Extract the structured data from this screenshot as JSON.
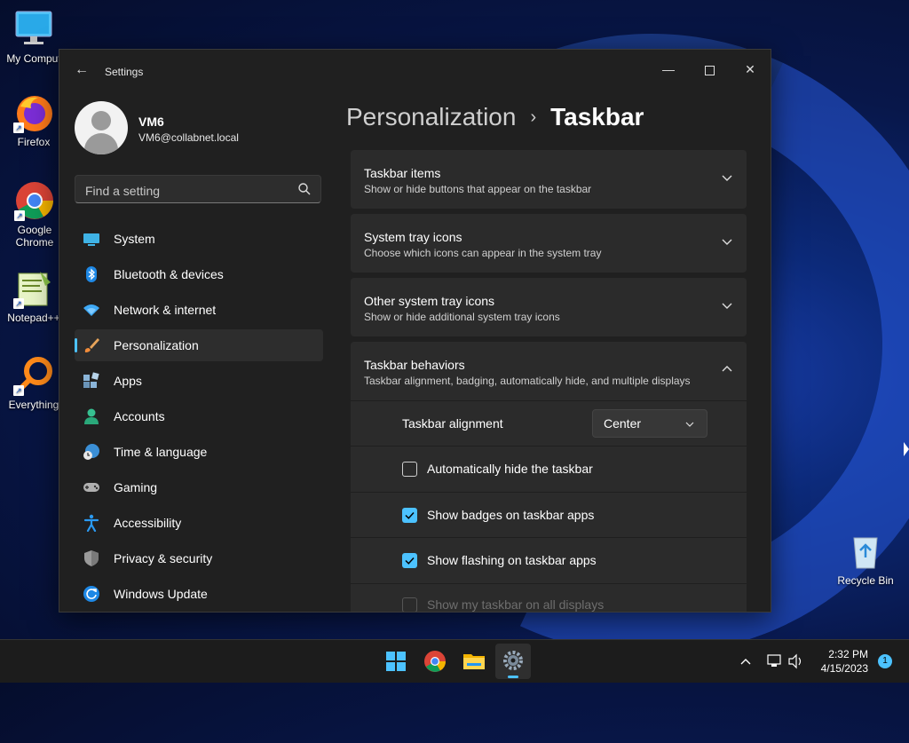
{
  "desktop": {
    "icons": [
      {
        "label": "My Comput"
      },
      {
        "label": "Firefox"
      },
      {
        "label": "Google Chrome"
      },
      {
        "label": "Notepad++"
      },
      {
        "label": "Everything"
      },
      {
        "label": "Recycle Bin"
      }
    ]
  },
  "window": {
    "title": "Settings",
    "minimize_label": "—",
    "close_label": "✕",
    "back_label": "←"
  },
  "profile": {
    "name": "VM6",
    "email": "VM6@collabnet.local"
  },
  "search": {
    "placeholder": "Find a setting"
  },
  "nav": {
    "items": [
      {
        "label": "System",
        "icon": "system-icon"
      },
      {
        "label": "Bluetooth & devices",
        "icon": "bluetooth-icon"
      },
      {
        "label": "Network & internet",
        "icon": "wifi-icon"
      },
      {
        "label": "Personalization",
        "icon": "brush-icon",
        "active": true
      },
      {
        "label": "Apps",
        "icon": "apps-icon"
      },
      {
        "label": "Accounts",
        "icon": "person-icon"
      },
      {
        "label": "Time & language",
        "icon": "clock-globe-icon"
      },
      {
        "label": "Gaming",
        "icon": "gamepad-icon"
      },
      {
        "label": "Accessibility",
        "icon": "accessibility-icon"
      },
      {
        "label": "Privacy & security",
        "icon": "shield-icon"
      },
      {
        "label": "Windows Update",
        "icon": "update-icon"
      }
    ]
  },
  "breadcrumb": {
    "parent": "Personalization",
    "separator": "›",
    "current": "Taskbar"
  },
  "sections": [
    {
      "title": "Taskbar items",
      "subtitle": "Show or hide buttons that appear on the taskbar",
      "expanded": false
    },
    {
      "title": "System tray icons",
      "subtitle": "Choose which icons can appear in the system tray",
      "expanded": false
    },
    {
      "title": "Other system tray icons",
      "subtitle": "Show or hide additional system tray icons",
      "expanded": false
    },
    {
      "title": "Taskbar behaviors",
      "subtitle": "Taskbar alignment, badging, automatically hide, and multiple displays",
      "expanded": true
    }
  ],
  "behaviors": {
    "alignment_label": "Taskbar alignment",
    "alignment_value": "Center",
    "options": [
      {
        "label": "Automatically hide the taskbar",
        "checked": false
      },
      {
        "label": "Show badges on taskbar apps",
        "checked": true
      },
      {
        "label": "Show flashing on taskbar apps",
        "checked": true
      },
      {
        "label": "Show my taskbar on all displays",
        "checked": false,
        "disabled": true
      }
    ]
  },
  "taskbar": {
    "time": "2:32 PM",
    "date": "4/15/2023",
    "notification_count": "1"
  },
  "colors": {
    "accent": "#4cc2ff",
    "window_bg": "#202020",
    "card_bg": "#2b2b2b"
  }
}
